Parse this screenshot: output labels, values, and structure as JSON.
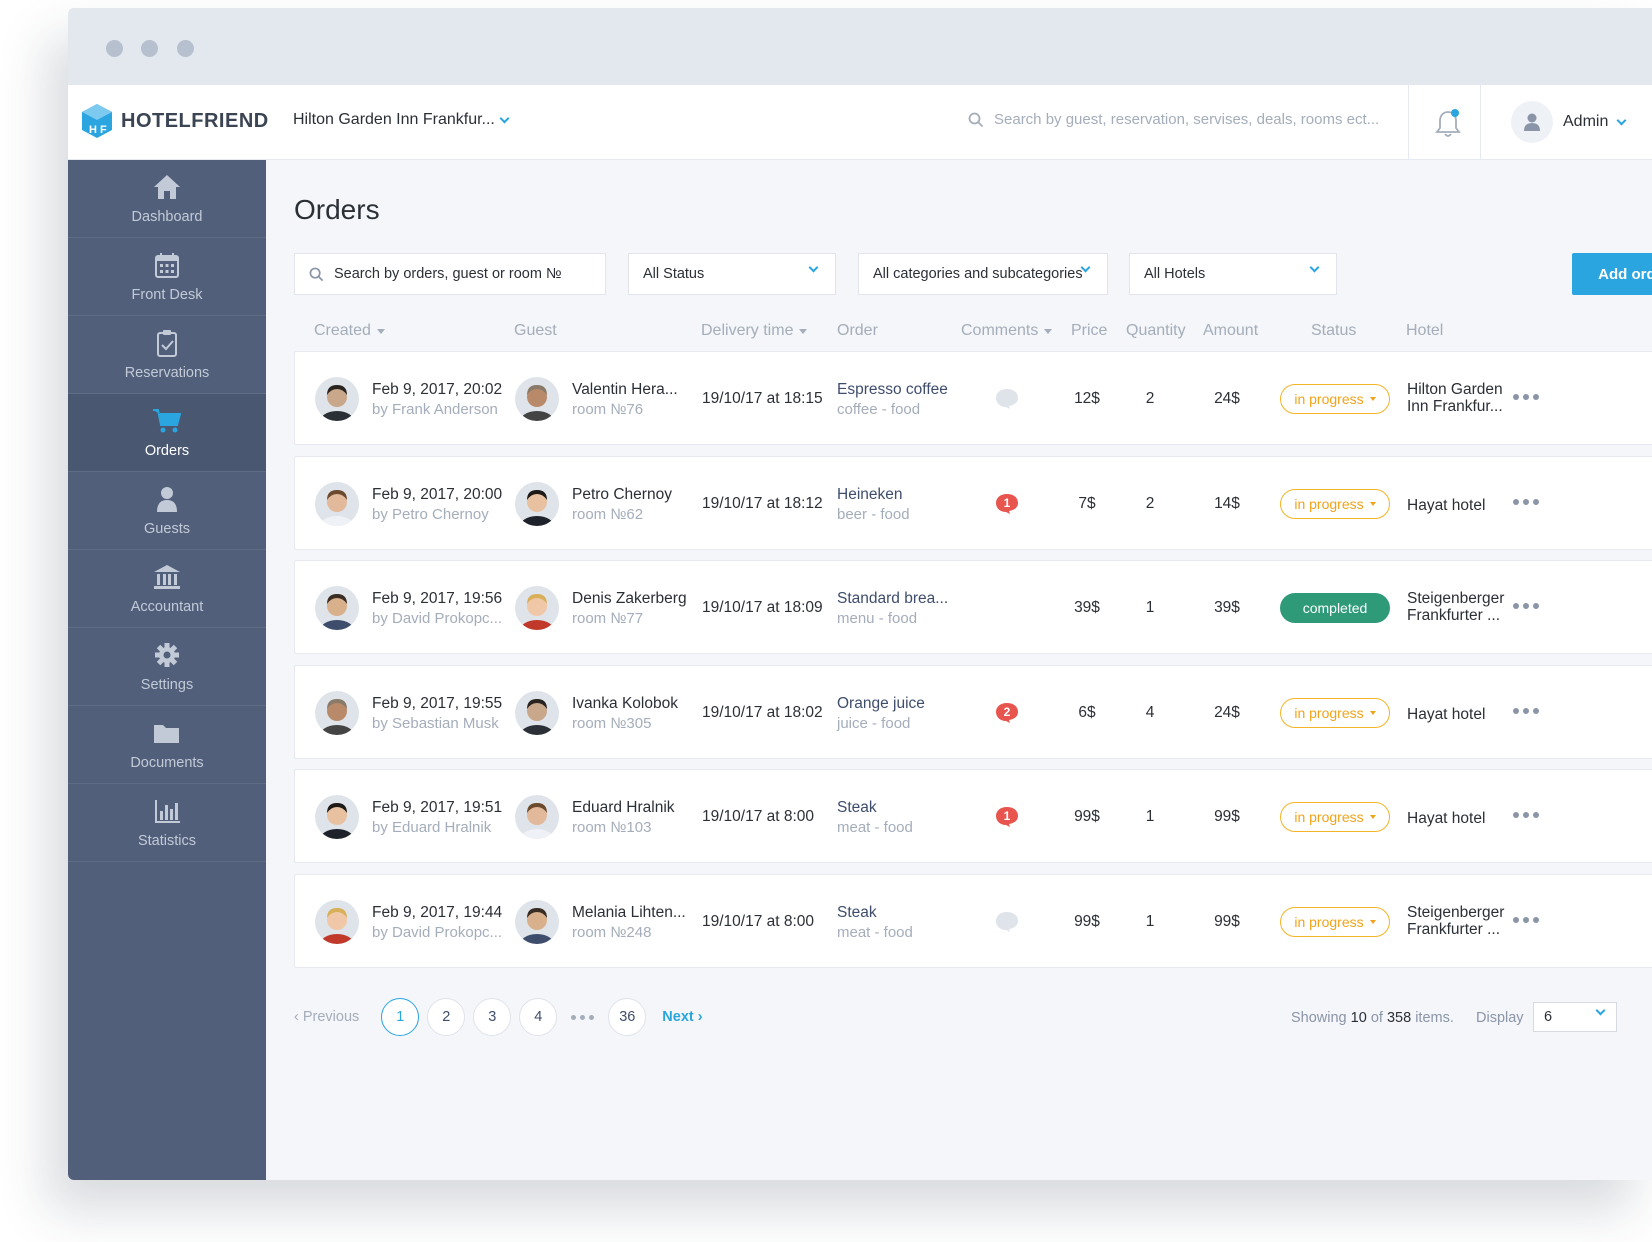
{
  "brand": {
    "name": "HOTELFRIEND"
  },
  "header": {
    "hotel_selector": "Hilton Garden Inn Frankfur...",
    "search_placeholder": "Search by guest, reservation, servises, deals, rooms ect...",
    "user_name": "Admin"
  },
  "sidebar": {
    "items": [
      {
        "label": "Dashboard",
        "icon": "home-icon"
      },
      {
        "label": "Front Desk",
        "icon": "calendar-icon"
      },
      {
        "label": "Reservations",
        "icon": "clipboard-check-icon"
      },
      {
        "label": "Orders",
        "icon": "cart-icon",
        "active": true
      },
      {
        "label": "Guests",
        "icon": "user-icon"
      },
      {
        "label": "Accountant",
        "icon": "bank-icon"
      },
      {
        "label": "Settings",
        "icon": "gear-icon"
      },
      {
        "label": "Documents",
        "icon": "folder-icon"
      },
      {
        "label": "Statistics",
        "icon": "bar-chart-icon"
      }
    ]
  },
  "page": {
    "title": "Orders",
    "search_placeholder": "Search by orders, guest or room №",
    "filters": {
      "status": "All Status",
      "categories": "All categories and subcategories",
      "hotels": "All Hotels"
    },
    "add_button": "Add order"
  },
  "table": {
    "columns": [
      "Created",
      "Guest",
      "Delivery time",
      "Order",
      "Comments",
      "Price",
      "Quantity",
      "Amount",
      "Status",
      "Hotel"
    ],
    "rows": [
      {
        "created": "Feb 9, 2017, 20:02",
        "by": "by Frank Anderson",
        "guest": "Valentin Hera...",
        "room": "room №76",
        "delivery": "19/10/17 at 18:15",
        "order": "Espresso coffee",
        "category": "coffee - food",
        "comments": "",
        "price": "12$",
        "quantity": "2",
        "amount": "24$",
        "status": "in progress",
        "hotel_line1": "Hilton Garden",
        "hotel_line2": "Inn Frankfur..."
      },
      {
        "created": "Feb 9, 2017, 20:00",
        "by": "by Petro Chernoy",
        "guest": "Petro Chernoy",
        "room": "room №62",
        "delivery": "19/10/17 at 18:12",
        "order": "Heineken",
        "category": "beer - food",
        "comments": "1",
        "price": "7$",
        "quantity": "2",
        "amount": "14$",
        "status": "in progress",
        "hotel_line1": "Hayat hotel",
        "hotel_line2": ""
      },
      {
        "created": "Feb 9, 2017, 19:56",
        "by": "by David Prokopc...",
        "guest": "Denis Zakerberg",
        "room": "room №77",
        "delivery": "19/10/17 at 18:09",
        "order": "Standard brea...",
        "category": "menu - food",
        "comments": "none",
        "price": "39$",
        "quantity": "1",
        "amount": "39$",
        "status": "completed",
        "hotel_line1": "Steigenberger",
        "hotel_line2": "Frankfurter ..."
      },
      {
        "created": "Feb 9, 2017, 19:55",
        "by": "by Sebastian Musk",
        "guest": "Ivanka Kolobok",
        "room": "room №305",
        "delivery": "19/10/17 at 18:02",
        "order": "Orange juice",
        "category": "juice - food",
        "comments": "2",
        "price": "6$",
        "quantity": "4",
        "amount": "24$",
        "status": "in progress",
        "hotel_line1": "Hayat hotel",
        "hotel_line2": ""
      },
      {
        "created": "Feb 9, 2017, 19:51",
        "by": "by Eduard Hralnik",
        "guest": "Eduard Hralnik",
        "room": "room №103",
        "delivery": "19/10/17 at 8:00",
        "order": "Steak",
        "category": "meat - food",
        "comments": "1",
        "price": "99$",
        "quantity": "1",
        "amount": "99$",
        "status": "in progress",
        "hotel_line1": "Hayat hotel",
        "hotel_line2": ""
      },
      {
        "created": "Feb 9, 2017, 19:44",
        "by": "by David Prokopc...",
        "guest": "Melania Lihten...",
        "room": "room №248",
        "delivery": "19/10/17 at 8:00",
        "order": "Steak",
        "category": "meat - food",
        "comments": "",
        "price": "99$",
        "quantity": "1",
        "amount": "99$",
        "status": "in progress",
        "hotel_line1": "Steigenberger",
        "hotel_line2": "Frankfurter ..."
      }
    ]
  },
  "pagination": {
    "previous": "Previous",
    "pages": [
      "1",
      "2",
      "3",
      "4",
      "36"
    ],
    "current": "1",
    "next": "Next",
    "showing_prefix": "Showing",
    "showing_count": "10",
    "showing_of": "of",
    "showing_total": "358",
    "showing_suffix": "items.",
    "display_label": "Display",
    "display_value": "6"
  },
  "colors": {
    "accent": "#2aa5e0",
    "sidebar": "#515f7a",
    "in_progress": "#f0a319",
    "completed": "#2e9a77",
    "comment_badge": "#e8554e"
  }
}
